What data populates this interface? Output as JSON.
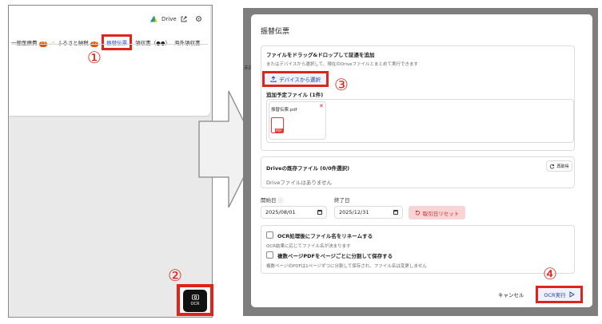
{
  "left": {
    "drive_label": "Drive",
    "tabs": [
      {
        "label": "一般医療費",
        "badge": "23"
      },
      {
        "label": "ふるさと納税",
        "badge": "12"
      },
      {
        "label": "振替伝票"
      },
      {
        "label": "領収書（●●）"
      },
      {
        "label": "海外領収書"
      }
    ],
    "fab_label": "OCR"
  },
  "markers": [
    "①",
    "②",
    "③",
    "④"
  ],
  "dialog": {
    "title": "振替伝票",
    "partial_label": "未請",
    "upload": {
      "heading": "ファイルをドラッグ&ドロップして証憑を追加",
      "hint": "またはデバイスから選択して、現在のDriveファイルとまとめて実行できます",
      "button_label": "デバイスから選択",
      "pending_heading": "追加予定ファイル (1件)",
      "file_name": "振替伝票.pdf",
      "file_type": "PDF"
    },
    "drive": {
      "heading": "Driveの既存ファイル (0/0件選択)",
      "refresh_label": "再取得",
      "empty_text": "Driveファイルはありません"
    },
    "dates": {
      "start_label": "開始日",
      "start_value": "2025/08/01",
      "end_label": "終了日",
      "end_value": "2025/12/31",
      "reset_label": "取引日リセット"
    },
    "options": [
      {
        "label": "OCR処理後にファイル名をリネームする",
        "desc": "OCR結果に応じてファイル名が決まります",
        "checked": false
      },
      {
        "label": "複数ページPDFをページごとに分割して保存する",
        "desc": "複数ページのPDFは1ページずつに分割して保存され、ファイル名は変更しません",
        "checked": false
      }
    ],
    "cancel_label": "キャンセル",
    "run_label": "OCR実行"
  },
  "colors": {
    "accent": "#1e3c96",
    "highlight": "#e0241b",
    "badge": "#e65100",
    "danger": "#c62828"
  }
}
